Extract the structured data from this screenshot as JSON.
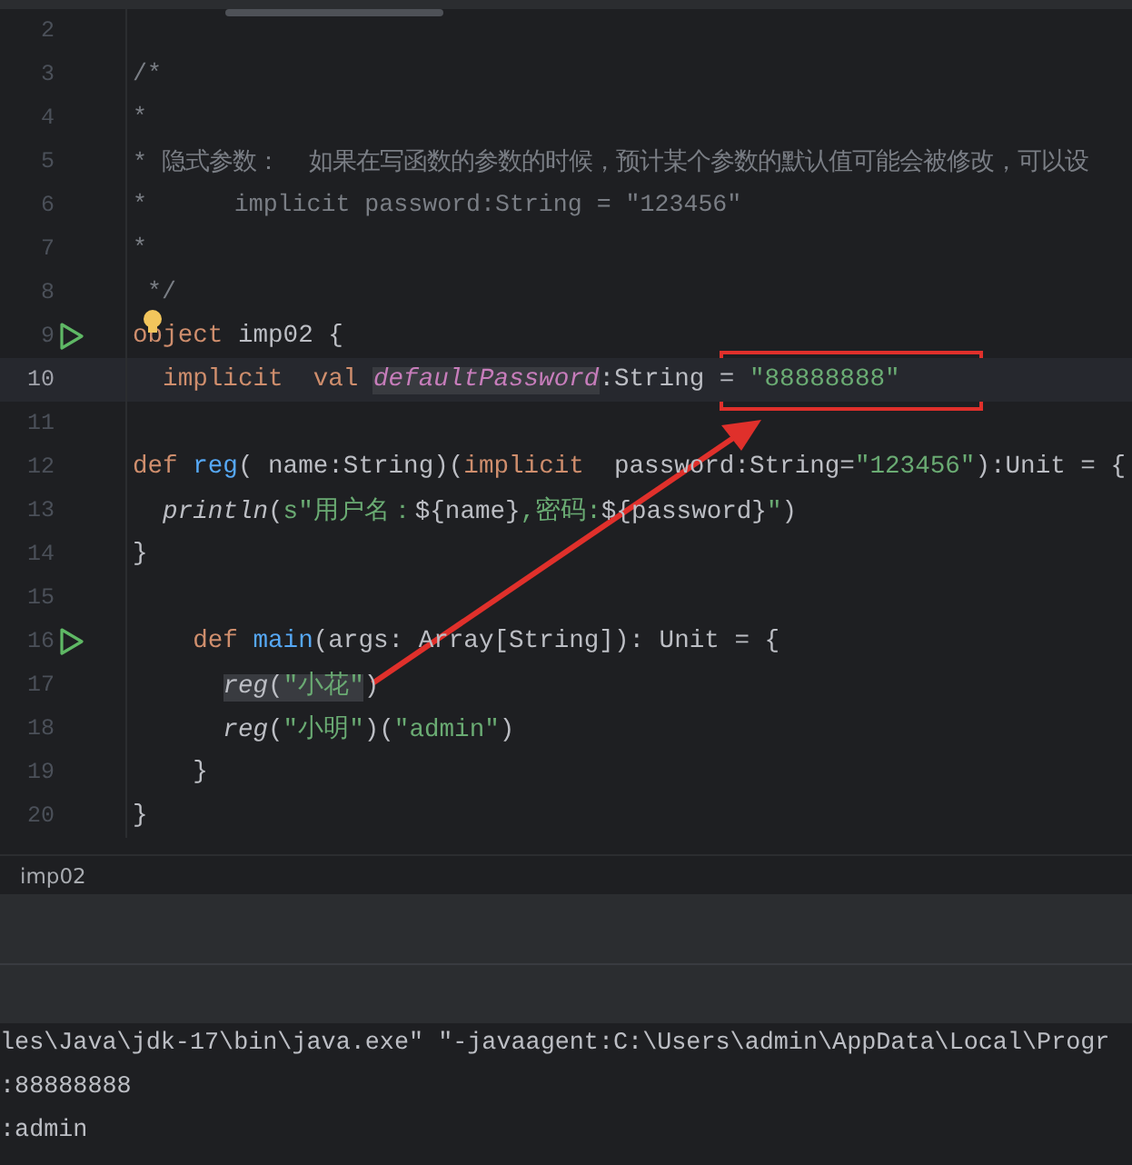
{
  "editor": {
    "lines": [
      {
        "number": "2",
        "current": false,
        "run": false,
        "bulb": false
      },
      {
        "number": "3",
        "current": false,
        "run": false,
        "bulb": false,
        "tokens": [
          {
            "kind": "comment",
            "text": "/*",
            "highlighted": false
          }
        ]
      },
      {
        "number": "4",
        "current": false,
        "run": false,
        "bulb": false,
        "tokens": [
          {
            "kind": "comment",
            "text": "*",
            "highlighted": false
          }
        ]
      },
      {
        "number": "5",
        "current": false,
        "run": false,
        "bulb": false,
        "tokens": [
          {
            "kind": "comment",
            "text": "* 隐式参数：  如果在写函数的参数的时候，预计某个参数的默认值可能会被修改，可以设",
            "highlighted": false
          }
        ]
      },
      {
        "number": "6",
        "current": false,
        "run": false,
        "bulb": false,
        "tokens": [
          {
            "kind": "comment",
            "text": "*      implicit password:String = \"123456\"",
            "highlighted": false
          }
        ]
      },
      {
        "number": "7",
        "current": false,
        "run": false,
        "bulb": false,
        "tokens": [
          {
            "kind": "comment",
            "text": "*",
            "highlighted": false
          }
        ]
      },
      {
        "number": "8",
        "current": false,
        "run": false,
        "bulb": false,
        "tokens": [
          {
            "kind": "comment",
            "text": " */",
            "highlighted": false
          }
        ]
      },
      {
        "number": "9",
        "current": false,
        "run": true,
        "bulb": true,
        "tokens": [
          {
            "kind": "keyword",
            "text": "object",
            "highlighted": false
          },
          {
            "kind": "plain",
            "text": " imp02 {",
            "highlighted": false
          }
        ]
      },
      {
        "number": "10",
        "current": true,
        "run": false,
        "bulb": false,
        "tokens": [
          {
            "kind": "keyword",
            "text": "  implicit  val ",
            "highlighted": false
          },
          {
            "kind": "field",
            "text": "defaultPassword",
            "highlighted": true
          },
          {
            "kind": "plain",
            "text": ":String = ",
            "highlighted": false
          },
          {
            "kind": "string",
            "text": "\"88888888\"",
            "highlighted": false
          }
        ]
      },
      {
        "number": "11",
        "current": false,
        "run": false,
        "bulb": false
      },
      {
        "number": "12",
        "current": false,
        "run": false,
        "bulb": false,
        "tokens": [
          {
            "kind": "keyword",
            "text": "def ",
            "highlighted": false
          },
          {
            "kind": "function",
            "text": "reg",
            "highlighted": false
          },
          {
            "kind": "plain",
            "text": "( name:String)(",
            "highlighted": false
          },
          {
            "kind": "keyword",
            "text": "implicit",
            "highlighted": false
          },
          {
            "kind": "plain",
            "text": "  password:String=",
            "highlighted": false
          },
          {
            "kind": "string",
            "text": "\"123456\"",
            "highlighted": false
          },
          {
            "kind": "plain",
            "text": "):Unit = {",
            "highlighted": false
          }
        ]
      },
      {
        "number": "13",
        "current": false,
        "run": false,
        "bulb": false,
        "tokens": [
          {
            "kind": "call",
            "text": "  println",
            "highlighted": false
          },
          {
            "kind": "plain",
            "text": "(",
            "highlighted": false
          },
          {
            "kind": "string",
            "text": "s\"用户名：",
            "highlighted": false
          },
          {
            "kind": "plain",
            "text": "${name}",
            "highlighted": false
          },
          {
            "kind": "string",
            "text": ",密码:",
            "highlighted": false
          },
          {
            "kind": "plain",
            "text": "${password}",
            "highlighted": false
          },
          {
            "kind": "string",
            "text": "\"",
            "highlighted": false
          },
          {
            "kind": "plain",
            "text": ")",
            "highlighted": false
          }
        ]
      },
      {
        "number": "14",
        "current": false,
        "run": false,
        "bulb": false,
        "tokens": [
          {
            "kind": "plain",
            "text": "}",
            "highlighted": false
          }
        ]
      },
      {
        "number": "15",
        "current": false,
        "run": false,
        "bulb": false
      },
      {
        "number": "16",
        "current": false,
        "run": true,
        "bulb": false,
        "tokens": [
          {
            "kind": "keyword",
            "text": "    def ",
            "highlighted": false
          },
          {
            "kind": "function",
            "text": "main",
            "highlighted": false
          },
          {
            "kind": "plain",
            "text": "(args: Array[String]): Unit = {",
            "highlighted": false
          }
        ]
      },
      {
        "number": "17",
        "current": false,
        "run": false,
        "bulb": false,
        "tokens": [
          {
            "kind": "call",
            "text": "      reg",
            "highlighted": true
          },
          {
            "kind": "plain",
            "text": "(",
            "highlighted": true
          },
          {
            "kind": "string",
            "text": "\"小花\"",
            "highlighted": true
          },
          {
            "kind": "plain",
            "text": ")",
            "highlighted": false
          }
        ]
      },
      {
        "number": "18",
        "current": false,
        "run": false,
        "bulb": false,
        "tokens": [
          {
            "kind": "call",
            "text": "      reg",
            "highlighted": false
          },
          {
            "kind": "plain",
            "text": "(",
            "highlighted": false
          },
          {
            "kind": "string",
            "text": "\"小明\"",
            "highlighted": false
          },
          {
            "kind": "plain",
            "text": ")(",
            "highlighted": false
          },
          {
            "kind": "string",
            "text": "\"admin\"",
            "highlighted": false
          },
          {
            "kind": "plain",
            "text": ")",
            "highlighted": false
          }
        ]
      },
      {
        "number": "19",
        "current": false,
        "run": false,
        "bulb": false,
        "tokens": [
          {
            "kind": "plain",
            "text": "    }",
            "highlighted": false
          }
        ]
      },
      {
        "number": "20",
        "current": false,
        "run": false,
        "bulb": false,
        "tokens": [
          {
            "kind": "plain",
            "text": "}",
            "highlighted": false
          }
        ]
      }
    ]
  },
  "breadcrumb": [
    "imp02"
  ],
  "console": {
    "lines": [
      "les\\Java\\jdk-17\\bin\\java.exe\" \"-javaagent:C:\\Users\\admin\\AppData\\Local\\Progr",
      ":88888888",
      ":admin"
    ]
  }
}
